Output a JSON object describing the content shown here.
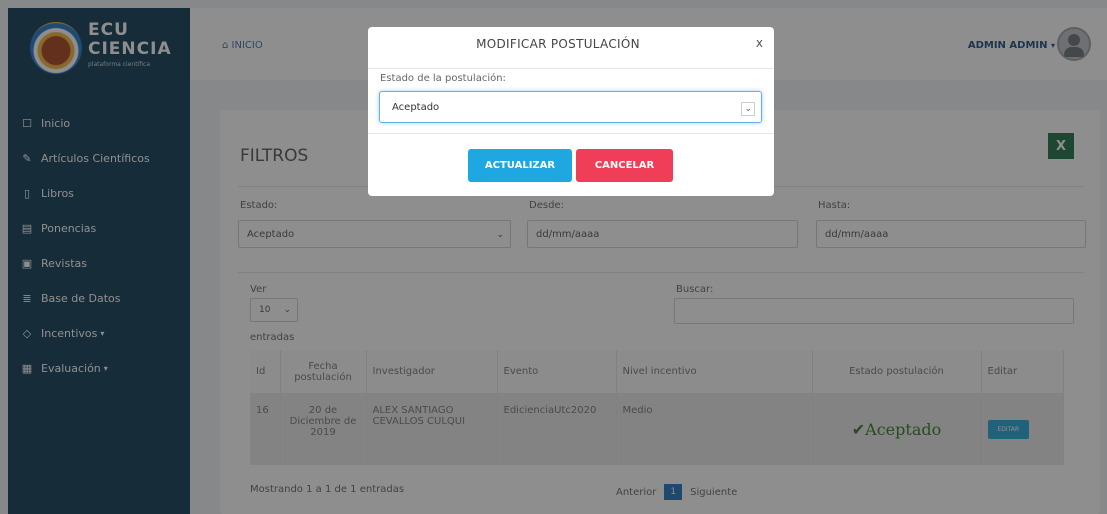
{
  "brand": {
    "line1": "ECU",
    "line2": "CIENCIA",
    "tagline": "plataforma científica"
  },
  "sidebar": {
    "items": [
      {
        "label": "Inicio",
        "icon": "square-icon"
      },
      {
        "label": "Artículos Científicos",
        "icon": "edit-icon"
      },
      {
        "label": "Libros",
        "icon": "book-icon"
      },
      {
        "label": "Ponencias",
        "icon": "document-icon"
      },
      {
        "label": "Revistas",
        "icon": "journal-icon"
      },
      {
        "label": "Base de Datos",
        "icon": "database-icon"
      },
      {
        "label": "Incentivos",
        "icon": "tag-icon"
      },
      {
        "label": "Evaluación",
        "icon": "clipboard-icon"
      }
    ]
  },
  "header": {
    "breadcrumb": "INICIO",
    "user": "ADMIN ADMIN"
  },
  "filters": {
    "title": "FILTROS",
    "estado_label": "Estado:",
    "estado_value": "Aceptado",
    "desde_label": "Desde:",
    "desde_placeholder": "dd/mm/aaaa",
    "hasta_label": "Hasta:",
    "hasta_placeholder": "dd/mm/aaaa"
  },
  "table_controls": {
    "ver_label": "Ver",
    "ver_value": "10",
    "entradas_label": "entradas",
    "buscar_label": "Buscar:"
  },
  "table": {
    "headers": [
      "Id",
      "Fecha postulación",
      "Investigador",
      "Evento",
      "Nivel incentivo",
      "Estado postulación",
      "Editar"
    ],
    "rows": [
      {
        "id": "16",
        "fecha": "20 de Diciembre de 2019",
        "investigador": "ALEX SANTIAGO CEVALLOS CULQUI",
        "evento": "EdicienciaUtc2020",
        "nivel": "Medio",
        "estado": "Aceptado",
        "editar": "EDITAR"
      }
    ]
  },
  "footer": {
    "info": "Mostrando 1 a 1 de 1 entradas",
    "prev": "Anterior",
    "page": "1",
    "next": "Siguiente"
  },
  "modal": {
    "title": "MODIFICAR POSTULACIÓN",
    "close": "x",
    "field_label": "Estado de la postulación:",
    "field_value": "Aceptado",
    "update_button": "ACTUALIZAR",
    "cancel_button": "CANCELAR"
  },
  "colors": {
    "sidebar": "#0f3d55",
    "accent": "#1ea7e1",
    "danger": "#f03e58",
    "success": "#2f7a22"
  }
}
